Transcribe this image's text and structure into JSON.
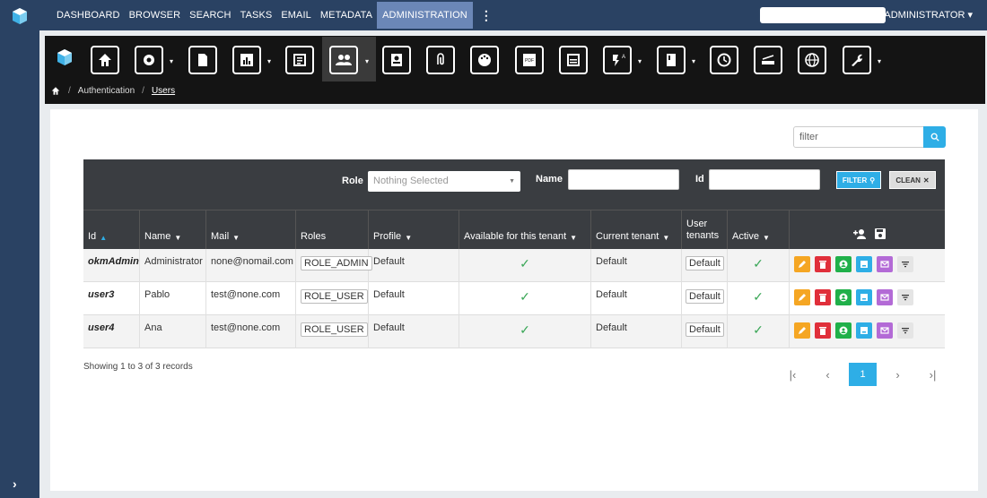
{
  "nav": {
    "items": [
      {
        "label": "DASHBOARD"
      },
      {
        "label": "BROWSER"
      },
      {
        "label": "SEARCH"
      },
      {
        "label": "TASKS"
      },
      {
        "label": "EMAIL"
      },
      {
        "label": "METADATA"
      },
      {
        "label": "ADMINISTRATION",
        "active": true
      }
    ],
    "user": "ADMINISTRATOR"
  },
  "toolbar_icons": [
    "home-icon",
    "settings-icon",
    "document-icon",
    "chart-icon",
    "list-icon",
    "users-icon",
    "user-icon",
    "paperclip-icon",
    "palette-icon",
    "pdf-icon",
    "calendar-icon",
    "automation-icon",
    "book-icon",
    "clock-icon",
    "scanner-icon",
    "globe-icon",
    "wrench-icon"
  ],
  "breadcrumb": {
    "section": "Authentication",
    "page": "Users"
  },
  "search": {
    "placeholder": "filter"
  },
  "filters": {
    "role_label": "Role",
    "role_placeholder": "Nothing Selected",
    "name_label": "Name",
    "id_label": "Id",
    "filter_button": "FILTER",
    "clean_button": "CLEAN"
  },
  "columns": [
    "Id",
    "Name",
    "Mail",
    "Roles",
    "Profile",
    "Available for this tenant",
    "Current tenant",
    "User",
    "tenants",
    "Active"
  ],
  "rows": [
    {
      "id": "okmAdmin",
      "name": "Administrator",
      "mail": "none@nomail.com",
      "role": "ROLE_ADMIN",
      "profile": "Default",
      "current_tenant": "Default",
      "user_tenant": "Default"
    },
    {
      "id": "user3",
      "name": "Pablo",
      "mail": "test@none.com",
      "role": "ROLE_USER",
      "profile": "Default",
      "current_tenant": "Default",
      "user_tenant": "Default"
    },
    {
      "id": "user4",
      "name": "Ana",
      "mail": "test@none.com",
      "role": "ROLE_USER",
      "profile": "Default",
      "current_tenant": "Default",
      "user_tenant": "Default"
    }
  ],
  "status_text": "Showing 1 to 3 of 3 records",
  "pagination": {
    "current": "1"
  },
  "colors": {
    "accent": "#2eaee6",
    "nav": "#2a4263",
    "edit": "#f5a623",
    "delete": "#e02f3a",
    "green": "#20b04a",
    "blue": "#2eaee6",
    "purple": "#b36ad6"
  }
}
